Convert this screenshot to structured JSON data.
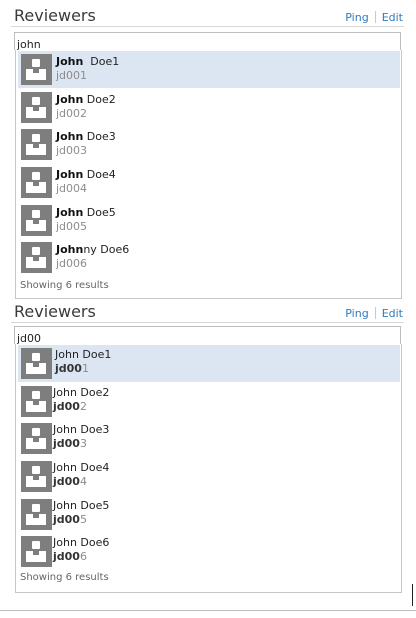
{
  "top": {
    "title": "Reviewers",
    "ping": "Ping",
    "edit": "Edit",
    "query": "john",
    "footer": "Showing 6 results",
    "rows": [
      {
        "m": "John",
        "r": "  Doe1",
        "id": "jd001"
      },
      {
        "m": "John",
        "r": " Doe2",
        "id": "jd002"
      },
      {
        "m": "John",
        "r": " Doe3",
        "id": "jd003"
      },
      {
        "m": "John",
        "r": " Doe4",
        "id": "jd004"
      },
      {
        "m": "John",
        "r": " Doe5",
        "id": "jd005"
      },
      {
        "m": "John",
        "r": "ny Doe6",
        "id": "jd006"
      }
    ]
  },
  "bottom": {
    "title": "Reviewers",
    "ping": "Ping",
    "edit": "Edit",
    "query": "jd00",
    "footer": "Showing 6 results",
    "rows": [
      {
        "name": "John Doe1",
        "m": "jd00",
        "r": "1"
      },
      {
        "name": "John Doe2",
        "m": "jd00",
        "r": "2"
      },
      {
        "name": "John Doe3",
        "m": "jd00",
        "r": "3"
      },
      {
        "name": "John Doe4",
        "m": "jd00",
        "r": "4"
      },
      {
        "name": "John Doe5",
        "m": "jd00",
        "r": "5"
      },
      {
        "name": "John Doe6",
        "m": "jd00",
        "r": "6"
      }
    ]
  },
  "icons": {
    "avatar": "person-placeholder-icon"
  }
}
